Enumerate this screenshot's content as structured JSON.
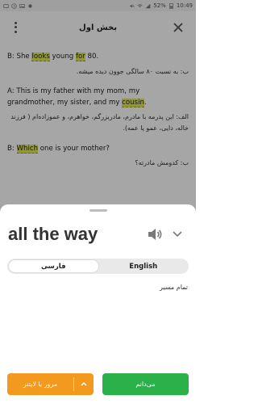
{
  "status_bar": {
    "battery": "52%",
    "time": "10:49"
  },
  "header": {
    "title": "بخش اول"
  },
  "content": {
    "p1_en_before": "B: She ",
    "p1_hl1": "looks",
    "p1_en_mid": " young ",
    "p1_hl2": "for",
    "p1_en_after": " 80.",
    "p1_fa": "ب: به نسبت ۸۰ سالگی جوون دیده میشه.",
    "p2_en_line1": "A: This is my father with my mom, my",
    "p2_en_line2_before": "grandmother, my sister, and my ",
    "p2_hl": "cousin",
    "p2_en_line2_after": ".",
    "p2_fa_line1": "الف: این پدرمه با مادرم، مادربزرگم، خواهرم، و عموزاده‌ام ( فرزند",
    "p2_fa_line2": "خاله، دایی، عمو یا عمه).",
    "p3_en_before": "B: ",
    "p3_hl": "Which",
    "p3_en_after": " one is your mother?",
    "p3_fa": "ب: کدومش مادرته؟"
  },
  "sheet": {
    "word": "all the way",
    "icons": {
      "speaker": "speaker-icon",
      "expand": "chevron-down-icon"
    },
    "tabs": [
      {
        "label": "فارسی",
        "active": true
      },
      {
        "label": "English",
        "active": false
      }
    ],
    "meaning": "تمام مسیر",
    "buttons": {
      "review": "مرور با لایتنر",
      "know": "می‌دانم"
    }
  },
  "colors": {
    "highlight": "#dfe95a",
    "orange": "#f39a1e",
    "green": "#2ab14a"
  }
}
